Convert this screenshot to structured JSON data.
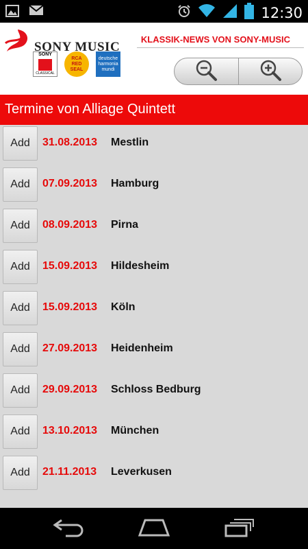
{
  "status_bar": {
    "time": "12:30",
    "icons": [
      "image-icon",
      "mail-icon",
      "alarm-icon",
      "wifi-icon",
      "signal-icon",
      "battery-icon"
    ]
  },
  "header": {
    "brand_name": "SONY MUSIC",
    "tagline": "KLASSIK-NEWS VON SONY-MUSIC",
    "labels": {
      "sony": {
        "line1": "SONY",
        "line2": "CLASSICAL"
      },
      "rca": {
        "line1": "RCA",
        "line2": "RED",
        "line3": "SEAL"
      },
      "dhm": {
        "line1": "deutsche",
        "line2": "harmonia",
        "line3": "mundi"
      }
    },
    "accent_color": "#e3111b"
  },
  "title_bar": {
    "title": "Termine von Alliage Quintett",
    "color": "#ed0a0a"
  },
  "events": [
    {
      "add_label": "Add",
      "date": "31.08.2013",
      "city": "Mestlin"
    },
    {
      "add_label": "Add",
      "date": "07.09.2013",
      "city": "Hamburg"
    },
    {
      "add_label": "Add",
      "date": "08.09.2013",
      "city": "Pirna"
    },
    {
      "add_label": "Add",
      "date": "15.09.2013",
      "city": "Hildesheim"
    },
    {
      "add_label": "Add",
      "date": "15.09.2013",
      "city": "Köln"
    },
    {
      "add_label": "Add",
      "date": "27.09.2013",
      "city": "Heidenheim"
    },
    {
      "add_label": "Add",
      "date": "29.09.2013",
      "city": "Schloss Bedburg"
    },
    {
      "add_label": "Add",
      "date": "13.10.2013",
      "city": "München"
    },
    {
      "add_label": "Add",
      "date": "21.11.2013",
      "city": "Leverkusen"
    }
  ],
  "nav_bar": {
    "icons": [
      "back-icon",
      "home-icon",
      "recent-apps-icon"
    ]
  }
}
